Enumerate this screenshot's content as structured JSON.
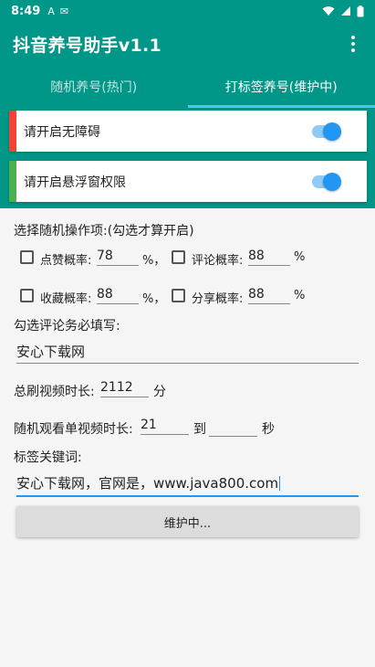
{
  "status_bar": {
    "time": "8:49",
    "notif_a": "A",
    "notif_b": "✉"
  },
  "app_bar": {
    "title": "抖音养号助手v1.1"
  },
  "tabs": [
    {
      "label": "随机养号(热门)",
      "active": false
    },
    {
      "label": "打标签养号(维护中)",
      "active": true
    }
  ],
  "permissions": [
    {
      "label": "请开启无障碍",
      "enabled": true,
      "accent": "#f44336"
    },
    {
      "label": "请开启悬浮窗权限",
      "enabled": true,
      "accent": "#4caf50"
    }
  ],
  "form": {
    "section_title": "选择随机操作项:(勾选才算开启)",
    "options": [
      {
        "label": "点赞概率:",
        "value": "78",
        "suffix": "%，"
      },
      {
        "label": "评论概率:",
        "value": "88",
        "suffix": "%"
      },
      {
        "label": "收藏概率:",
        "value": "88",
        "suffix": "%，"
      },
      {
        "label": "分享概率:",
        "value": "88",
        "suffix": "%"
      }
    ],
    "comment_label": "勾选评论务必填写:",
    "comment_value": "安心下载网",
    "total_label": "总刷视频时长:",
    "total_value": "2112",
    "total_unit": "分",
    "watch_label": "随机观看单视频时长:",
    "watch_min": "21",
    "watch_to": "到",
    "watch_max": "",
    "watch_unit": "秒",
    "keywords_label": "标签关键词:",
    "keywords_value": "安心下载网，官网是，www.java800.com",
    "button_label": "维护中..."
  },
  "colors": {
    "primary": "#009688",
    "accent": "#2196f3",
    "tab_indicator": "#4fc3f7"
  }
}
